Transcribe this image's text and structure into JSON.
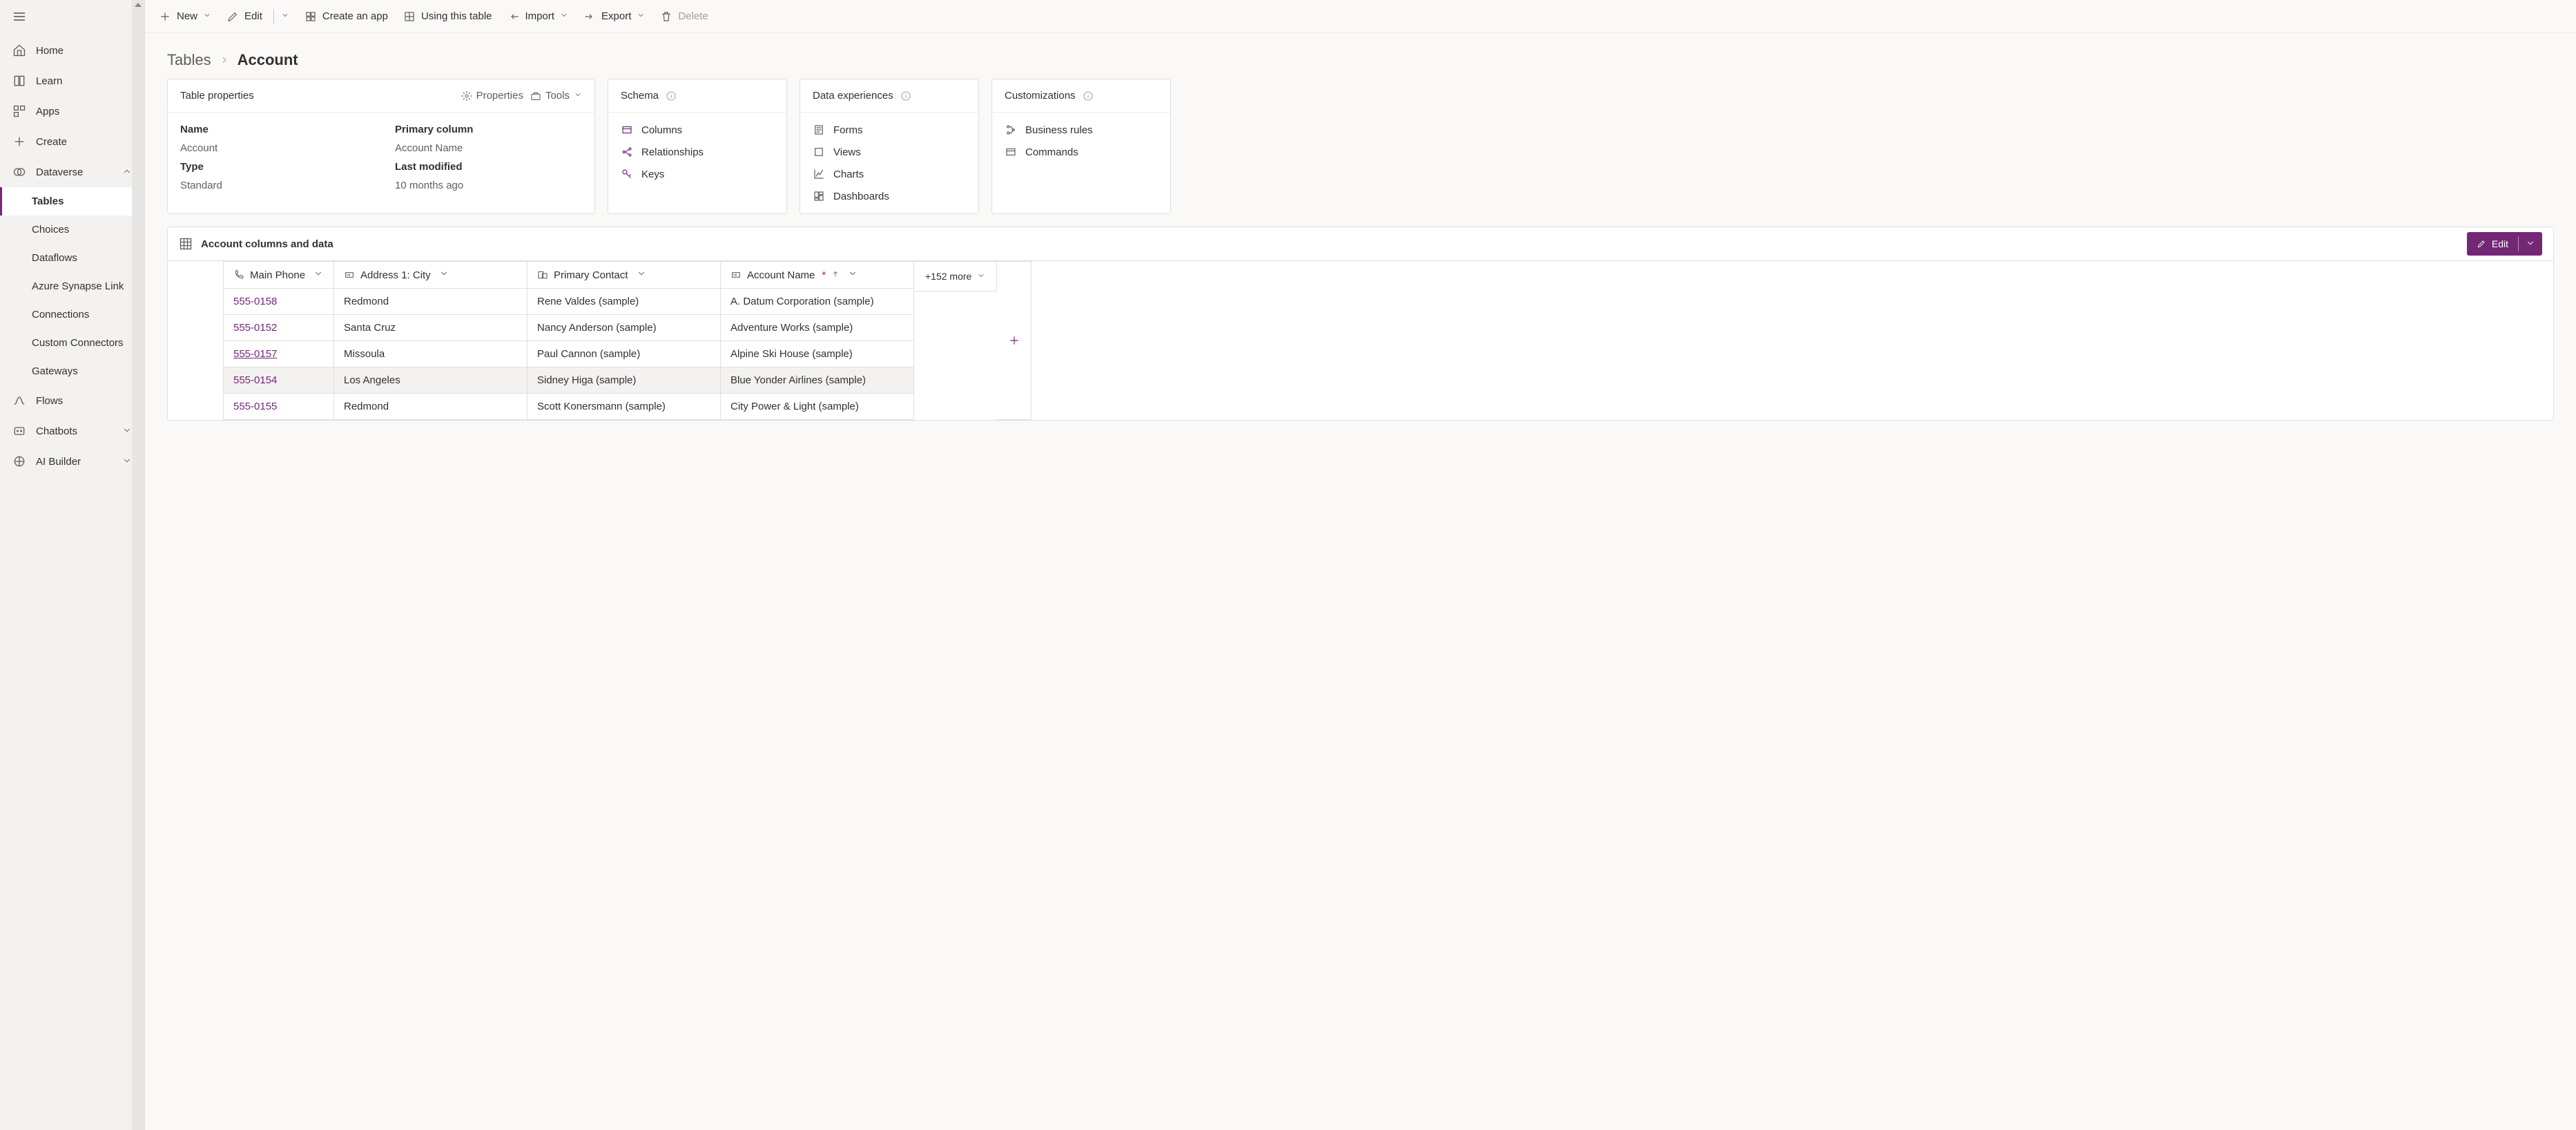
{
  "sidebar": {
    "items": [
      {
        "label": "Home"
      },
      {
        "label": "Learn"
      },
      {
        "label": "Apps"
      },
      {
        "label": "Create"
      },
      {
        "label": "Dataverse",
        "expanded": true,
        "children": [
          {
            "label": "Tables",
            "active": true
          },
          {
            "label": "Choices"
          },
          {
            "label": "Dataflows"
          },
          {
            "label": "Azure Synapse Link"
          },
          {
            "label": "Connections"
          },
          {
            "label": "Custom Connectors"
          },
          {
            "label": "Gateways"
          }
        ]
      },
      {
        "label": "Flows"
      },
      {
        "label": "Chatbots",
        "expandable": true
      },
      {
        "label": "AI Builder",
        "expandable": true
      }
    ]
  },
  "toolbar": {
    "new": "New",
    "edit": "Edit",
    "create_app": "Create an app",
    "using_table": "Using this table",
    "import": "Import",
    "export": "Export",
    "delete": "Delete"
  },
  "breadcrumb": {
    "root": "Tables",
    "current": "Account"
  },
  "cards": {
    "properties": {
      "title": "Table properties",
      "properties_btn": "Properties",
      "tools_btn": "Tools",
      "rows": {
        "name_k": "Name",
        "name_v": "Account",
        "primary_k": "Primary column",
        "primary_v": "Account Name",
        "type_k": "Type",
        "type_v": "Standard",
        "modified_k": "Last modified",
        "modified_v": "10 months ago"
      }
    },
    "schema": {
      "title": "Schema",
      "links": [
        {
          "label": "Columns"
        },
        {
          "label": "Relationships"
        },
        {
          "label": "Keys"
        }
      ]
    },
    "data_experiences": {
      "title": "Data experiences",
      "links": [
        {
          "label": "Forms"
        },
        {
          "label": "Views"
        },
        {
          "label": "Charts"
        },
        {
          "label": "Dashboards"
        }
      ]
    },
    "customizations": {
      "title": "Customizations",
      "links": [
        {
          "label": "Business rules"
        },
        {
          "label": "Commands"
        }
      ]
    }
  },
  "data_section": {
    "title": "Account columns and data",
    "edit_btn": "Edit",
    "more_label": "+152 more",
    "columns": {
      "phone": "Main Phone",
      "city": "Address 1: City",
      "contact": "Primary Contact",
      "account": "Account Name"
    },
    "rows": [
      {
        "phone": "555-0158",
        "city": "Redmond",
        "contact": "Rene Valdes (sample)",
        "account": "A. Datum Corporation (sample)"
      },
      {
        "phone": "555-0152",
        "city": "Santa Cruz",
        "contact": "Nancy Anderson (sample)",
        "account": "Adventure Works (sample)"
      },
      {
        "phone": "555-0157",
        "city": "Missoula",
        "contact": "Paul Cannon (sample)",
        "account": "Alpine Ski House (sample)",
        "underline": true
      },
      {
        "phone": "555-0154",
        "city": "Los Angeles",
        "contact": "Sidney Higa (sample)",
        "account": "Blue Yonder Airlines (sample)",
        "hover": true
      },
      {
        "phone": "555-0155",
        "city": "Redmond",
        "contact": "Scott Konersmann (sample)",
        "account": "City Power & Light (sample)"
      }
    ]
  }
}
